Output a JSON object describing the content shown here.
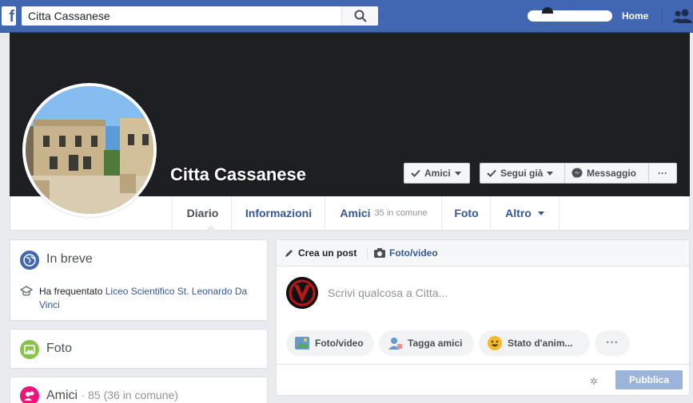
{
  "topbar": {
    "search_value": "Citta Cassanese",
    "home_label": "Home"
  },
  "profile": {
    "name": "Citta Cassanese"
  },
  "cover_buttons": {
    "amici": "Amici",
    "segui": "Segui già",
    "messaggio": "Messaggio",
    "more": "···"
  },
  "nav": {
    "tabs": [
      {
        "label": "Diario",
        "sub": ""
      },
      {
        "label": "Informazioni",
        "sub": ""
      },
      {
        "label": "Amici",
        "sub": "35 in comune"
      },
      {
        "label": "Foto",
        "sub": ""
      },
      {
        "label": "Altro",
        "sub": ""
      }
    ]
  },
  "intro": {
    "title": "In breve",
    "prefix": "Ha frequentato",
    "school": "Liceo Scientifico St. Leonardo Da Vinci"
  },
  "photos": {
    "title": "Foto"
  },
  "friends": {
    "title": "Amici",
    "count": "· 85 (36 in comune)"
  },
  "composer": {
    "tab_post": "Crea un post",
    "tab_photo": "Foto/video",
    "placeholder": "Scrivi qualcosa a Citta...",
    "pill_foto": "Foto/video",
    "pill_tagga": "Tagga amici",
    "pill_stato": "Stato d'anim...",
    "pill_more": "···",
    "publish": "Pubblica"
  },
  "colors": {
    "brand": "#4267b2",
    "link": "#365899",
    "cover": "#1e1f23"
  }
}
